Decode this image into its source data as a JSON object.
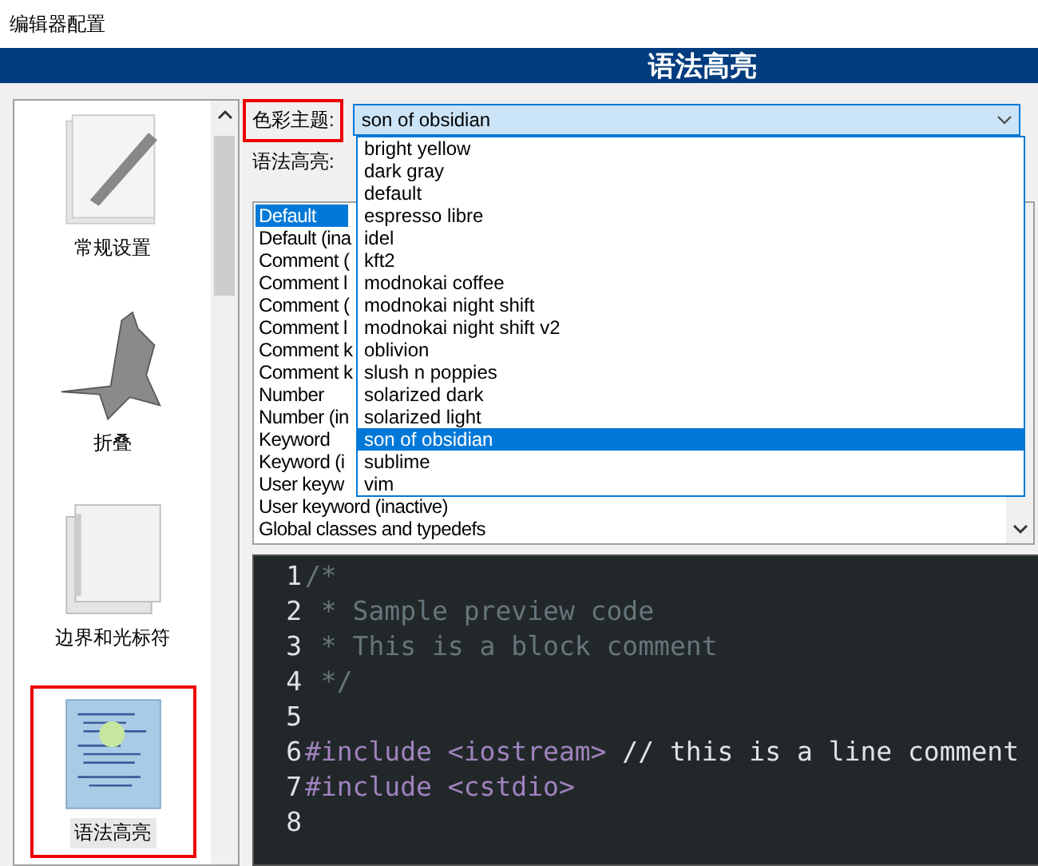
{
  "window": {
    "title": "编辑器配置"
  },
  "header": {
    "title": "语法高亮"
  },
  "sidebar": {
    "items": [
      {
        "label": "常规设置",
        "selected": false
      },
      {
        "label": "折叠",
        "selected": false
      },
      {
        "label": "边界和光标符",
        "selected": false
      },
      {
        "label": "语法高亮",
        "selected": true
      }
    ]
  },
  "color_theme": {
    "label": "色彩主题:",
    "value": "son of obsidian",
    "expanded": true,
    "options": [
      {
        "label": "bright yellow",
        "selected": false
      },
      {
        "label": "dark gray",
        "selected": false
      },
      {
        "label": "default",
        "selected": false
      },
      {
        "label": "espresso libre",
        "selected": false
      },
      {
        "label": "idel",
        "selected": false
      },
      {
        "label": "kft2",
        "selected": false
      },
      {
        "label": "modnokai coffee",
        "selected": false
      },
      {
        "label": "modnokai night shift",
        "selected": false
      },
      {
        "label": "modnokai night shift v2",
        "selected": false
      },
      {
        "label": "oblivion",
        "selected": false
      },
      {
        "label": "slush n poppies",
        "selected": false
      },
      {
        "label": "solarized dark",
        "selected": false
      },
      {
        "label": "solarized light",
        "selected": false
      },
      {
        "label": "son of obsidian",
        "selected": true
      },
      {
        "label": "sublime",
        "selected": false
      },
      {
        "label": "vim",
        "selected": false
      }
    ]
  },
  "syntax_label": "语法高亮:",
  "elements": [
    {
      "label": "Default",
      "selected": true
    },
    {
      "label": "Default (ina",
      "selected": false
    },
    {
      "label": "Comment (",
      "selected": false
    },
    {
      "label": "Comment l",
      "selected": false
    },
    {
      "label": "Comment (",
      "selected": false
    },
    {
      "label": "Comment l",
      "selected": false
    },
    {
      "label": "Comment k",
      "selected": false
    },
    {
      "label": "Comment k",
      "selected": false
    },
    {
      "label": "Number",
      "selected": false
    },
    {
      "label": "Number (in",
      "selected": false
    },
    {
      "label": "Keyword",
      "selected": false
    },
    {
      "label": "Keyword (i",
      "selected": false
    },
    {
      "label": "User keyw",
      "selected": false
    },
    {
      "label": "User keyword (inactive)",
      "selected": false
    },
    {
      "label": "Global classes and typedefs",
      "selected": false
    }
  ],
  "preview": {
    "lines": [
      {
        "number": "1",
        "tokens": [
          {
            "text": "/*",
            "kind": "comment"
          }
        ]
      },
      {
        "number": "2",
        "tokens": [
          {
            "text": " * Sample preview code",
            "kind": "comment"
          }
        ]
      },
      {
        "number": "3",
        "tokens": [
          {
            "text": " * This is a block comment",
            "kind": "comment"
          }
        ]
      },
      {
        "number": "4",
        "tokens": [
          {
            "text": " */",
            "kind": "comment"
          }
        ]
      },
      {
        "number": "5"
      },
      {
        "number": "6",
        "tokens": [
          {
            "text": "#include <iostream>",
            "kind": "preprocessor"
          },
          {
            "text": " // this is a line comment",
            "kind": "linecomment"
          }
        ]
      },
      {
        "number": "7",
        "tokens": [
          {
            "text": "#include <cstdio>",
            "kind": "preprocessor"
          }
        ]
      },
      {
        "number": "8"
      }
    ]
  }
}
